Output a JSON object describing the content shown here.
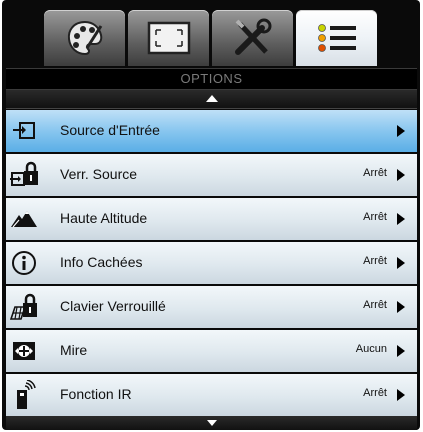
{
  "tabs": [
    {
      "icon": "palette-icon",
      "active": false
    },
    {
      "icon": "screen-resize-icon",
      "active": false
    },
    {
      "icon": "tools-icon",
      "active": false
    },
    {
      "icon": "list-menu-icon",
      "active": true
    }
  ],
  "title": "OPTIONS",
  "items": [
    {
      "icon": "input-source-icon",
      "label": "Source d'Entrée",
      "value": "",
      "selected": true
    },
    {
      "icon": "source-lock-icon",
      "label": "Verr. Source",
      "value": "Arrêt",
      "selected": false
    },
    {
      "icon": "high-altitude-icon",
      "label": "Haute Altitude",
      "value": "Arrêt",
      "selected": false
    },
    {
      "icon": "info-icon",
      "label": "Info Cachées",
      "value": "Arrêt",
      "selected": false
    },
    {
      "icon": "keypad-lock-icon",
      "label": "Clavier Verrouillé",
      "value": "Arrêt",
      "selected": false
    },
    {
      "icon": "test-pattern-icon",
      "label": "Mire",
      "value": "Aucun",
      "selected": false
    },
    {
      "icon": "ir-function-icon",
      "label": "Fonction IR",
      "value": "Arrêt",
      "selected": false
    }
  ],
  "colors": {
    "selected_row": "#5aaee6",
    "row": "#dfe8ee",
    "background": "#0a0a0a"
  }
}
